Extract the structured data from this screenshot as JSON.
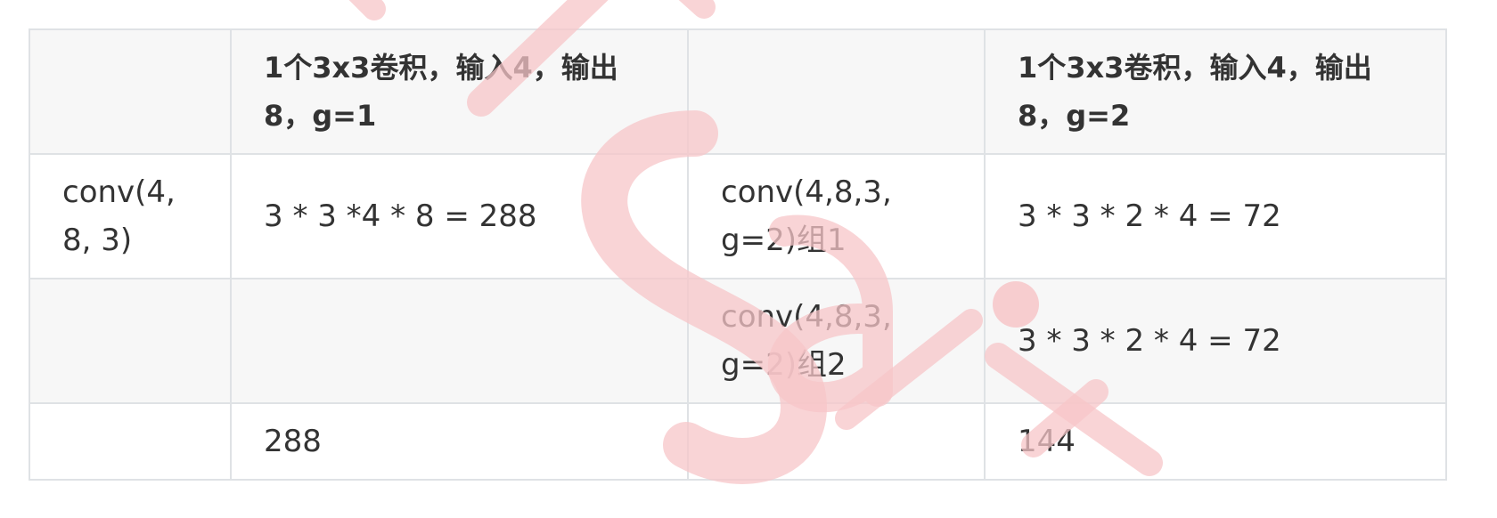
{
  "table": {
    "headers": [
      "",
      "1个3x3卷积，输入4，输出8，g=1",
      "",
      "1个3x3卷积，输入4，输出8，g=2"
    ],
    "rows": [
      [
        "conv(4, 8, 3)",
        "3 * 3 *4 * 8 = 288",
        "conv(4,8,3, g=2)组1",
        "3 * 3 * 2 * 4 = 72"
      ],
      [
        "",
        "",
        "conv(4,8,3, g=2)组2",
        "3 * 3 * 2 * 4 = 72"
      ],
      [
        "",
        "288",
        "",
        "144"
      ]
    ]
  },
  "watermark": {
    "text": "SaiT",
    "color": "#f7c6c8"
  }
}
